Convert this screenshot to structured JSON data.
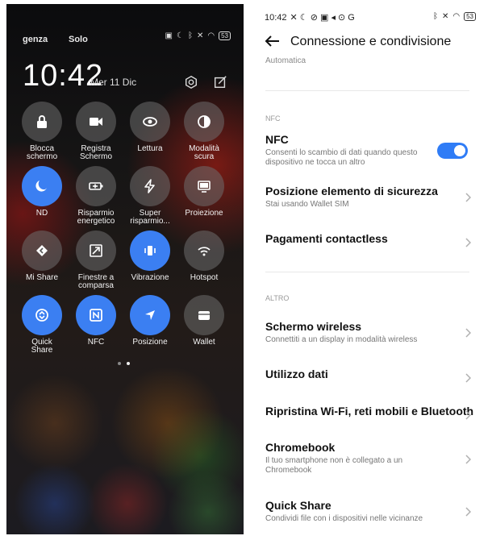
{
  "left": {
    "status_left": "genza",
    "status_mid": "Solo",
    "battery": "53",
    "time": "10:42",
    "date": "Mer 11 Dic",
    "settings_icon": "gear-icon",
    "edit_icon": "edit-icon",
    "tiles": [
      {
        "label": "Blocca\nschermo",
        "icon": "lock-icon",
        "on": false
      },
      {
        "label": "Registra\nSchermo",
        "icon": "video-camera-icon",
        "on": false
      },
      {
        "label": "Lettura",
        "icon": "eye-icon",
        "on": false
      },
      {
        "label": "Modalità\nscura",
        "icon": "dark-mode-icon",
        "on": false
      },
      {
        "label": "ND",
        "icon": "moon-icon",
        "on": true
      },
      {
        "label": "Risparmio\nenergetico",
        "icon": "battery-saver-icon",
        "on": false
      },
      {
        "label": "Super\nrisparmio...",
        "icon": "lightning-icon",
        "on": false
      },
      {
        "label": "Proiezione",
        "icon": "cast-screen-icon",
        "on": false
      },
      {
        "label": "Mi Share",
        "icon": "mi-share-icon",
        "on": false
      },
      {
        "label": "Finestre a\ncomparsa",
        "icon": "floating-window-icon",
        "on": false
      },
      {
        "label": "Vibrazione",
        "icon": "vibrate-icon",
        "on": true
      },
      {
        "label": "Hotspot",
        "icon": "hotspot-icon",
        "on": false
      },
      {
        "label": "Quick\nShare",
        "icon": "quick-share-icon",
        "on": true
      },
      {
        "label": "NFC",
        "icon": "nfc-icon",
        "on": true
      },
      {
        "label": "Posizione",
        "icon": "location-icon",
        "on": true
      },
      {
        "label": "Wallet",
        "icon": "wallet-icon",
        "on": false
      }
    ],
    "page_dots": 2,
    "active_dot": 2
  },
  "right": {
    "time": "10:42",
    "battery": "53",
    "title": "Connessione e condivisione",
    "truncated_sub": "Automatica",
    "sections": [
      {
        "header": "NFC"
      },
      {
        "header": "ALTRO"
      }
    ],
    "nfc": {
      "title": "NFC",
      "sub": "Consenti lo scambio di dati quando questo dispositivo ne tocca un altro",
      "enabled": true
    },
    "rows": [
      {
        "title": "Posizione elemento di sicurezza",
        "sub": "Stai usando Wallet SIM"
      },
      {
        "title": "Pagamenti contactless",
        "sub": ""
      },
      {
        "title": "Schermo wireless",
        "sub": "Connettiti a un display in modalità wireless"
      },
      {
        "title": "Utilizzo dati",
        "sub": ""
      },
      {
        "title": "Ripristina Wi-Fi, reti mobili e Bluetooth",
        "sub": ""
      },
      {
        "title": "Chromebook",
        "sub": "Il tuo smartphone non è collegato a un Chromebook"
      },
      {
        "title": "Quick Share",
        "sub": "Condividi file con i dispositivi nelle vicinanze"
      }
    ],
    "colors": {
      "accent": "#2f7cf6"
    }
  }
}
